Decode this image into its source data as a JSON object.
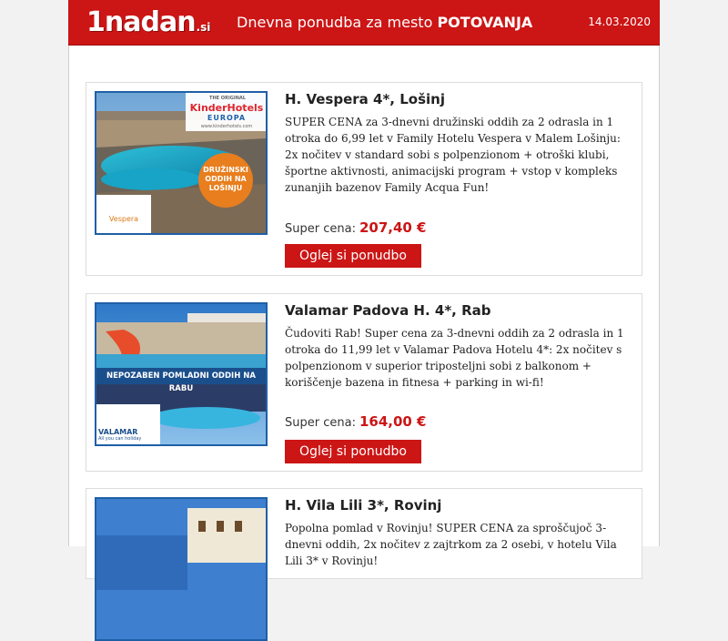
{
  "header": {
    "logo_text": "1nadan",
    "logo_tld": ".si",
    "headline_prefix": "Dnevna ponudba za mesto",
    "headline_city": "POTOVANJA",
    "date": "14.03.2020"
  },
  "offers": [
    {
      "title": "H. Vespera 4*, Lošinj",
      "description": "SUPER CENA za 3-dnevni družinski oddih za 2 odrasla in 1 otroka do 6,99 let v Family Hotelu Vespera v Malem Lošinju: 2x nočitev v standard sobi s polpenzionom + otroški klubi, športne aktivnosti, animacijski program + vstop v kompleks zunanjih bazenov Family Acqua Fun!",
      "price_label": "Super cena:",
      "price": "207,40 €",
      "button": "Oglej si ponudbo",
      "image": {
        "brand_top": "THE ORIGINAL",
        "brand": "KinderHotels",
        "brand_sub": "EUROPA",
        "brand_url": "www.kinderhotels.com",
        "badge": "DRUŽINSKI ODDIH NA LOŠINJU",
        "hotel_logo": "Vespera"
      }
    },
    {
      "title": "Valamar Padova H. 4*, Rab",
      "description": "Čudoviti Rab! Super cena za 3-dnevni oddih za 2 odrasla in 1 otroka do 11,99 let v Valamar Padova Hotelu 4*: 2x nočitev s polpenzionom v superior triposteljni sobi z balkonom + koriščenje bazena in fitnesa + parking in wi-fi!",
      "price_label": "Super cena:",
      "price": "164,00 €",
      "button": "Oglej si ponudbo",
      "image": {
        "banner": "NEPOZABEN POMLADNI ODDIH NA RABU",
        "brand": "VALAMAR",
        "brand_sub": "All you can holiday"
      }
    },
    {
      "title": "H. Vila Lili 3*, Rovinj",
      "description": "Popolna pomlad v Rovinju! SUPER CENA za sproščujoč 3-dnevni oddih, 2x nočitev z zajtrkom za 2 osebi, v hotelu Vila Lili 3* v Rovinju!"
    }
  ],
  "colors": {
    "accent": "#cc1515",
    "thumb_border": "#1f5fa6"
  }
}
